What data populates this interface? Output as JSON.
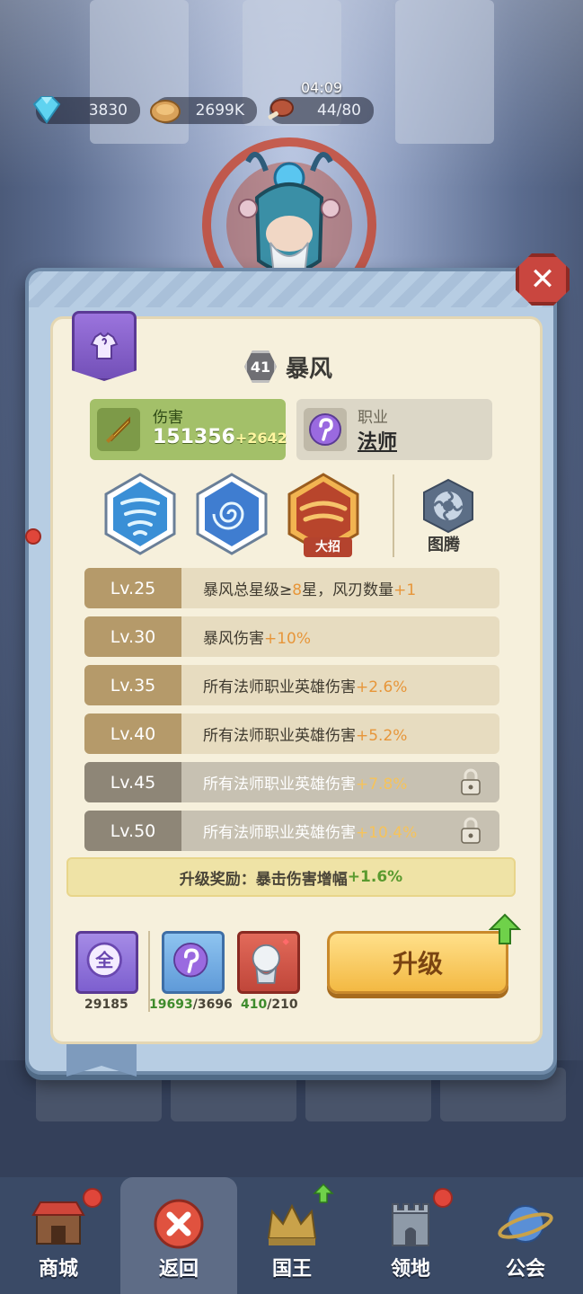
{
  "resources": {
    "gems": "3830",
    "gold": "2699K",
    "timer": "04:09",
    "stamina": "44/80"
  },
  "hero": {
    "level": "41",
    "name": "暴风"
  },
  "stats": {
    "damage_label": "伤害",
    "damage_value": "151356",
    "damage_bonus": "+2642",
    "class_label": "职业",
    "class_value": "法师"
  },
  "skills": {
    "ultimate_tag": "大招",
    "totem_label": "图腾"
  },
  "levels": [
    {
      "lv": "Lv.25",
      "pre": "暴风总星级≥",
      "hl1": "8",
      "mid": "星，风刃数量",
      "hl2": "+1",
      "locked": false
    },
    {
      "lv": "Lv.30",
      "pre": "暴风伤害",
      "hl1": "",
      "mid": "",
      "hl2": "+10%",
      "locked": false
    },
    {
      "lv": "Lv.35",
      "pre": "所有法师职业英雄伤害",
      "hl1": "",
      "mid": "",
      "hl2": "+2.6%",
      "locked": false
    },
    {
      "lv": "Lv.40",
      "pre": "所有法师职业英雄伤害",
      "hl1": "",
      "mid": "",
      "hl2": "+5.2%",
      "locked": false
    },
    {
      "lv": "Lv.45",
      "pre": "所有法师职业英雄伤害",
      "hl1": "",
      "mid": "",
      "hl2": "+7.8%",
      "locked": true
    },
    {
      "lv": "Lv.50",
      "pre": "所有法师职业英雄伤害",
      "hl1": "",
      "mid": "",
      "hl2": "+10.4%",
      "locked": true
    }
  ],
  "reward": {
    "text": "升级奖励：暴击伤害增幅",
    "value": "+1.6%"
  },
  "costs": {
    "universal_glyph": "全",
    "universal_count": "29185",
    "mage_have": "19693",
    "mage_need": "/3696",
    "hero_have": "410",
    "hero_need": "/210"
  },
  "upgrade_label": "升级",
  "nav": [
    {
      "label": "商城"
    },
    {
      "label": "返回"
    },
    {
      "label": "国王"
    },
    {
      "label": "领地"
    },
    {
      "label": "公会"
    }
  ],
  "colors": {
    "accent_green": "#a3c069",
    "highlight_orange": "#e7963a",
    "upgrade_yellow": "#f3b943",
    "close_red": "#c9463f"
  }
}
